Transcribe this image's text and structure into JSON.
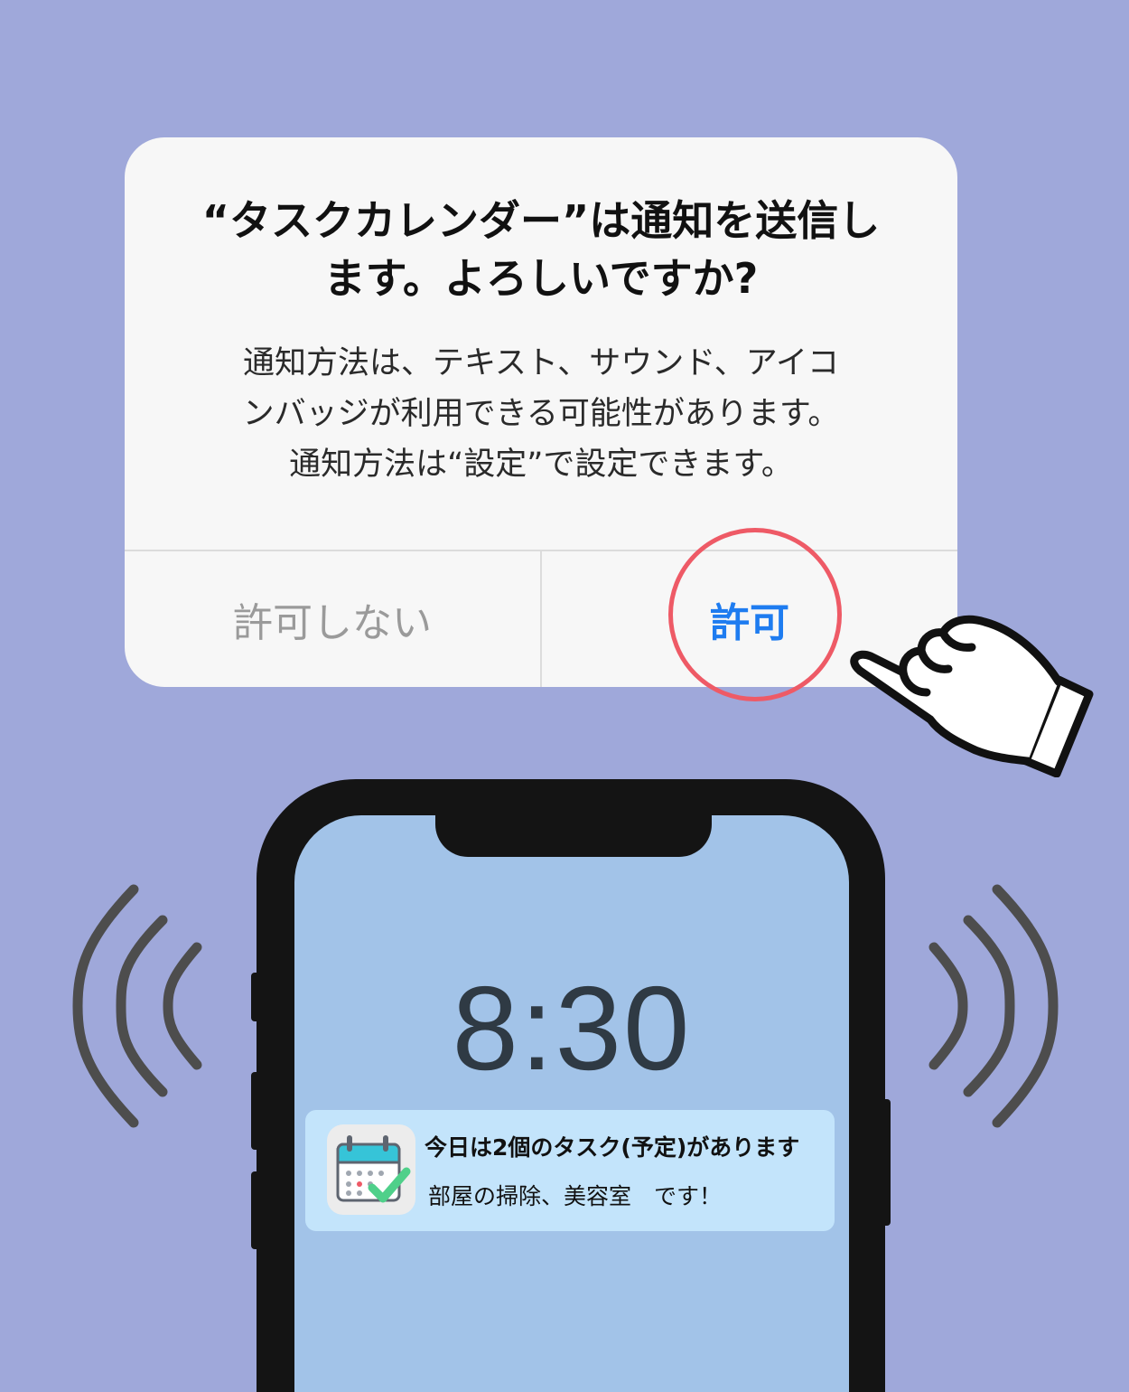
{
  "dialog": {
    "title_line1": "“タスクカレンダー”は通知を送信し",
    "title_line2": "ます。よろしいですか?",
    "message_line1": "通知方法は、テキスト、サウンド、アイコ",
    "message_line2": "ンバッジが利用できる可能性があります。",
    "message_line3": "通知方法は“設定”で設定できます。",
    "deny_label": "許可しない",
    "allow_label": "許可"
  },
  "lock_screen": {
    "time": "8:30",
    "notification": {
      "icon": "calendar-check-icon",
      "title": "今日は2個のタスク(予定)があります",
      "body": "部屋の掃除、美容室　です！"
    }
  },
  "colors": {
    "background": "#9fa8da",
    "allow_button": "#1e7cf0",
    "highlight_circle": "#ee5a66",
    "notification_bg": "#c3e4fb",
    "screen_bg": "#a2c3e8"
  }
}
